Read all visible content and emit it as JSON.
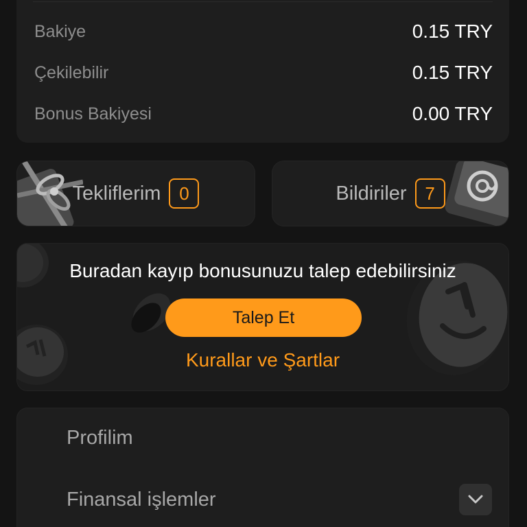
{
  "balance": {
    "rows": [
      {
        "label": "Bakiye",
        "value": "0.15 TRY"
      },
      {
        "label": "Çekilebilir",
        "value": "0.15 TRY"
      },
      {
        "label": "Bonus Bakiyesi",
        "value": "0.00 TRY"
      }
    ]
  },
  "tiles": {
    "offers": {
      "label": "Tekliflerim",
      "count": "0",
      "icon": "gift-icon"
    },
    "notifications": {
      "label": "Bildiriler",
      "count": "7",
      "icon": "at-sign-icon"
    }
  },
  "promo": {
    "title": "Buradan kayıp bonusunuzu talep edebilirsiniz",
    "button_label": "Talep Et",
    "link_label": "Kurallar ve Şartlar",
    "decoration_icon": "coin-icon"
  },
  "menu": {
    "items": [
      {
        "label": "Profilim"
      },
      {
        "label": "Finansal işlemler",
        "icon": "chevron-down-icon"
      }
    ]
  },
  "colors": {
    "accent": "#ff9a1a",
    "background": "#141414",
    "card": "#1e1e1e",
    "muted_text": "#8e8e8e"
  }
}
